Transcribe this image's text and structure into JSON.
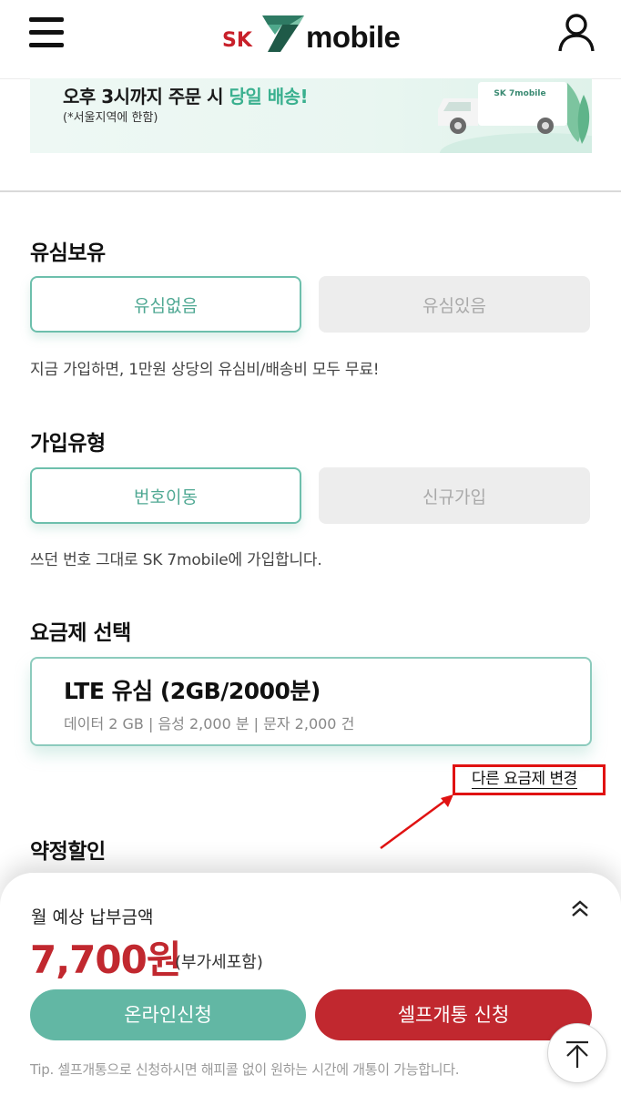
{
  "header": {
    "logo_sk": "SK",
    "logo_word": "mobile",
    "menu_icon": "hamburger-menu-icon",
    "user_icon": "user-profile-icon"
  },
  "banner": {
    "title_prefix": "오후 3시까지 주문 시 ",
    "title_highlight": "당일 배송!",
    "subtitle": "(*서울지역에 한함)",
    "truck_text": "SK 7mobile"
  },
  "usim": {
    "title": "유심보유",
    "options": [
      "유심없음",
      "유심있음"
    ],
    "selected": "유심없음",
    "description": "지금 가입하면, 1만원 상당의 유심비/배송비 모두 무료!"
  },
  "join_type": {
    "title": "가입유형",
    "options": [
      "번호이동",
      "신규가입"
    ],
    "selected": "번호이동",
    "description": "쓰던 번호 그대로 SK 7mobile에 가입합니다."
  },
  "plan": {
    "title": "요금제 선택",
    "name": "LTE 유심 (2GB/2000분)",
    "detail": "데이터 2 GB | 음성 2,000 분 | 문자 2,000 건",
    "change_link": "다른 요금제 변경"
  },
  "discount": {
    "title": "약정할인"
  },
  "bottom": {
    "label": "월 예상 납부금액",
    "price": "7,700원",
    "price_note": "(부가세포함)",
    "online_button": "온라인신청",
    "self_button": "셀프개통 신청",
    "tip": "Tip. 셀프개통으로 신청하시면 해피콜 없이 원하는 시간에 개통이 가능합니다.",
    "expand_icon": "double-chevron-up-icon",
    "top_icon": "scroll-to-top-icon"
  },
  "colors": {
    "accent_green": "#62b7a4",
    "brand_red": "#c1282f",
    "annotation_red": "#e01212"
  }
}
